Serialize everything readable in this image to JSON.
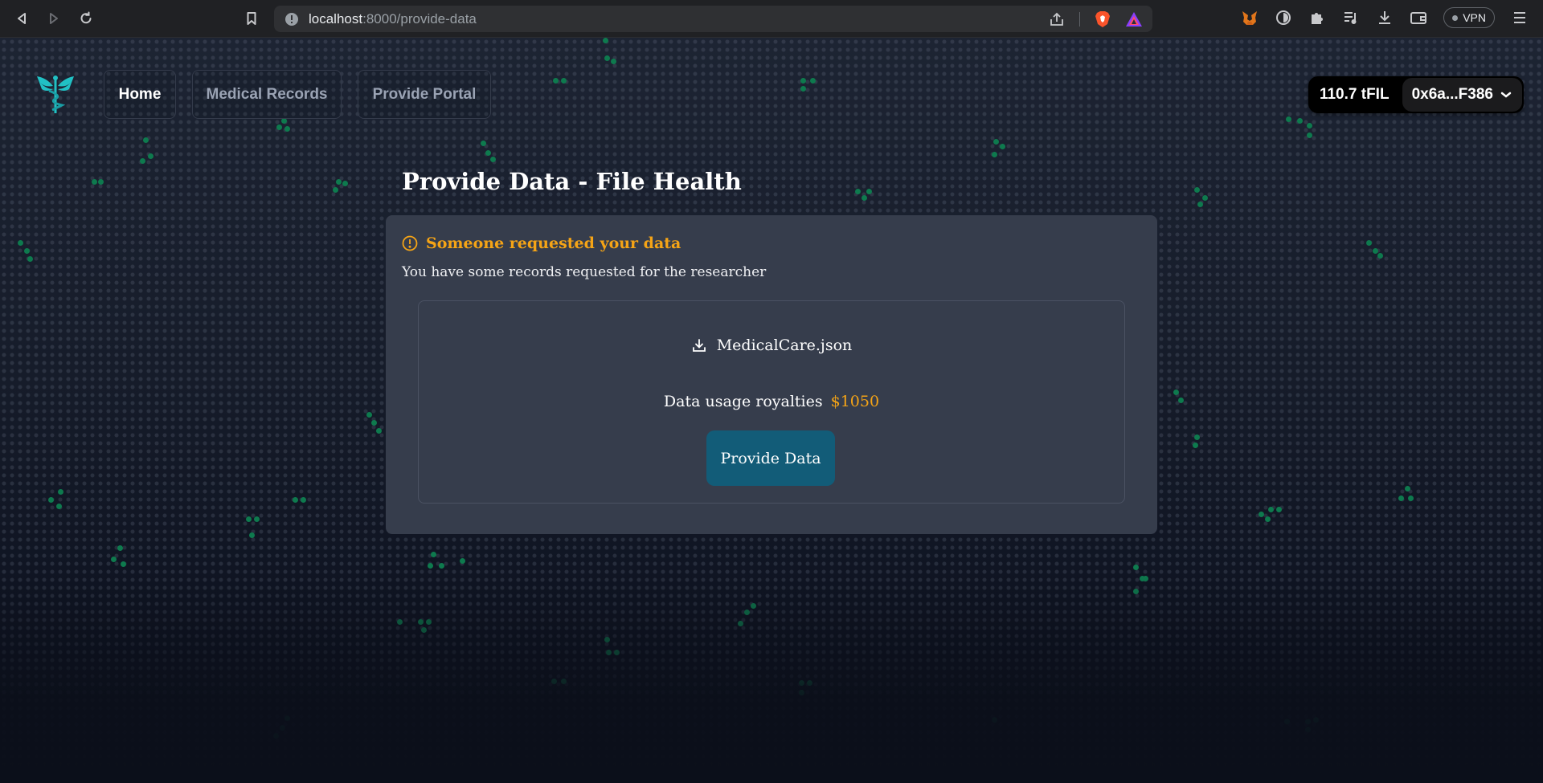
{
  "browser": {
    "url_host": "localhost",
    "url_path": ":8000/provide-data",
    "vpn_label": "VPN"
  },
  "nav": {
    "tabs": [
      {
        "label": "Home",
        "active": true
      },
      {
        "label": "Medical Records",
        "active": false
      },
      {
        "label": "Provide Portal",
        "active": false
      }
    ]
  },
  "wallet": {
    "balance": "110.7 tFIL",
    "address": "0x6a...F386"
  },
  "main": {
    "title": "Provide Data - File Health",
    "alert_title": "Someone requested your data",
    "alert_text": "You have some records requested for the researcher",
    "file_name": "MedicalCare.json",
    "royalty_label": "Data usage royalties",
    "royalty_value": "$1050",
    "provide_button": "Provide Data"
  },
  "colors": {
    "accent_orange": "#f5a416",
    "button_teal": "#125c78",
    "card_bg": "#363d4c",
    "logo_teal": "#21c1c4"
  }
}
